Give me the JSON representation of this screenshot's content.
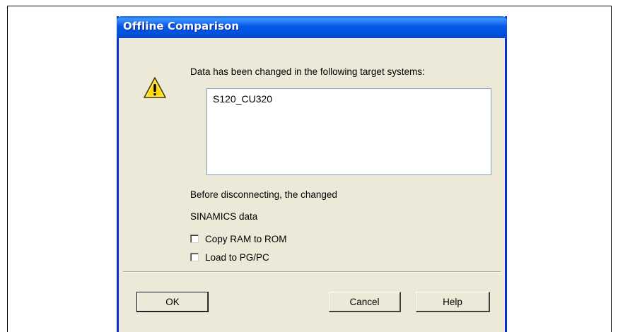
{
  "dialog": {
    "title": "Offline Comparison",
    "message": "Data has been changed in the following target systems:",
    "changed_systems": [
      "S120_CU320"
    ],
    "before_text": "Before disconnecting, the changed",
    "sinamics_text": "SINAMICS data",
    "icon": "warning-icon",
    "options": [
      {
        "label": "Copy RAM to ROM",
        "checked": false
      },
      {
        "label": "Load to PG/PC",
        "checked": false
      }
    ],
    "buttons": {
      "ok": "OK",
      "cancel": "Cancel",
      "help": "Help"
    }
  },
  "colors": {
    "titlebar": "#0054e3",
    "dialog_bg": "#ece9d8",
    "warning_fill": "#ffd800"
  }
}
